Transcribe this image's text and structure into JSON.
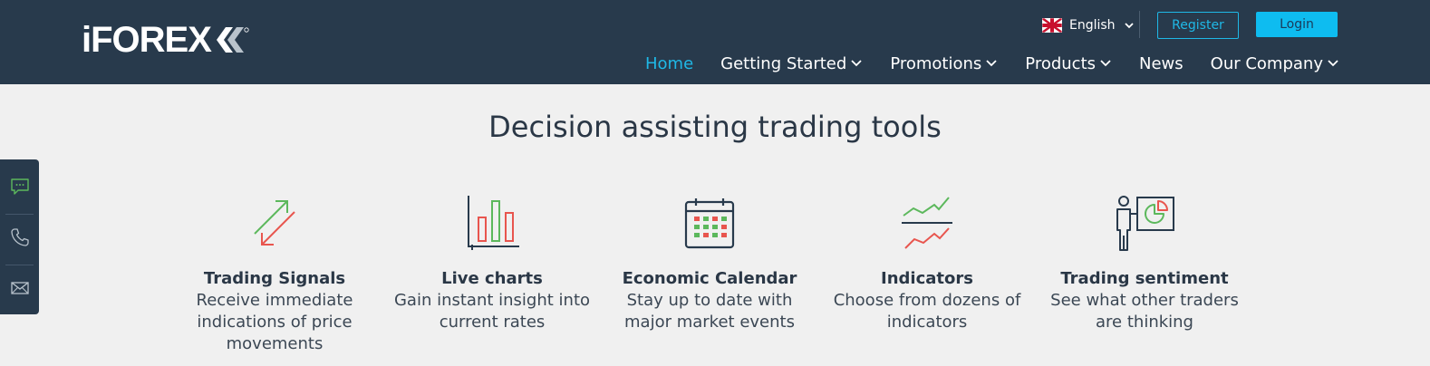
{
  "header": {
    "logo_text": "iFOREX",
    "language": "English",
    "register_label": "Register",
    "login_label": "Login",
    "nav": [
      {
        "label": "Home",
        "active": true,
        "dropdown": false
      },
      {
        "label": "Getting Started",
        "active": false,
        "dropdown": true
      },
      {
        "label": "Promotions",
        "active": false,
        "dropdown": true
      },
      {
        "label": "Products",
        "active": false,
        "dropdown": true
      },
      {
        "label": "News",
        "active": false,
        "dropdown": false
      },
      {
        "label": "Our Company",
        "active": false,
        "dropdown": true
      }
    ]
  },
  "main": {
    "heading": "Decision assisting trading tools",
    "tools": [
      {
        "title": "Trading Signals",
        "desc": [
          "Receive immediate",
          "indications of price",
          "movements"
        ],
        "icon": "trading-signals-icon"
      },
      {
        "title": "Live charts",
        "desc": [
          "Gain instant insight into",
          "current rates"
        ],
        "icon": "bar-chart-icon"
      },
      {
        "title": "Economic Calendar",
        "desc": [
          "Stay up to date with",
          "major market events"
        ],
        "icon": "calendar-icon"
      },
      {
        "title": "Indicators",
        "desc": [
          "Choose from dozens of",
          "indicators"
        ],
        "icon": "indicators-icon"
      },
      {
        "title": "Trading sentiment",
        "desc": [
          "See what other traders",
          "are thinking"
        ],
        "icon": "presentation-icon"
      }
    ]
  },
  "side_bar": {
    "items": [
      "chat-icon",
      "phone-icon",
      "mail-icon"
    ]
  },
  "colors": {
    "header_bg": "#283a4c",
    "accent": "#1fb8e6",
    "green": "#5cb85c",
    "red": "#e8554e",
    "page_bg": "#f0f0f0"
  }
}
